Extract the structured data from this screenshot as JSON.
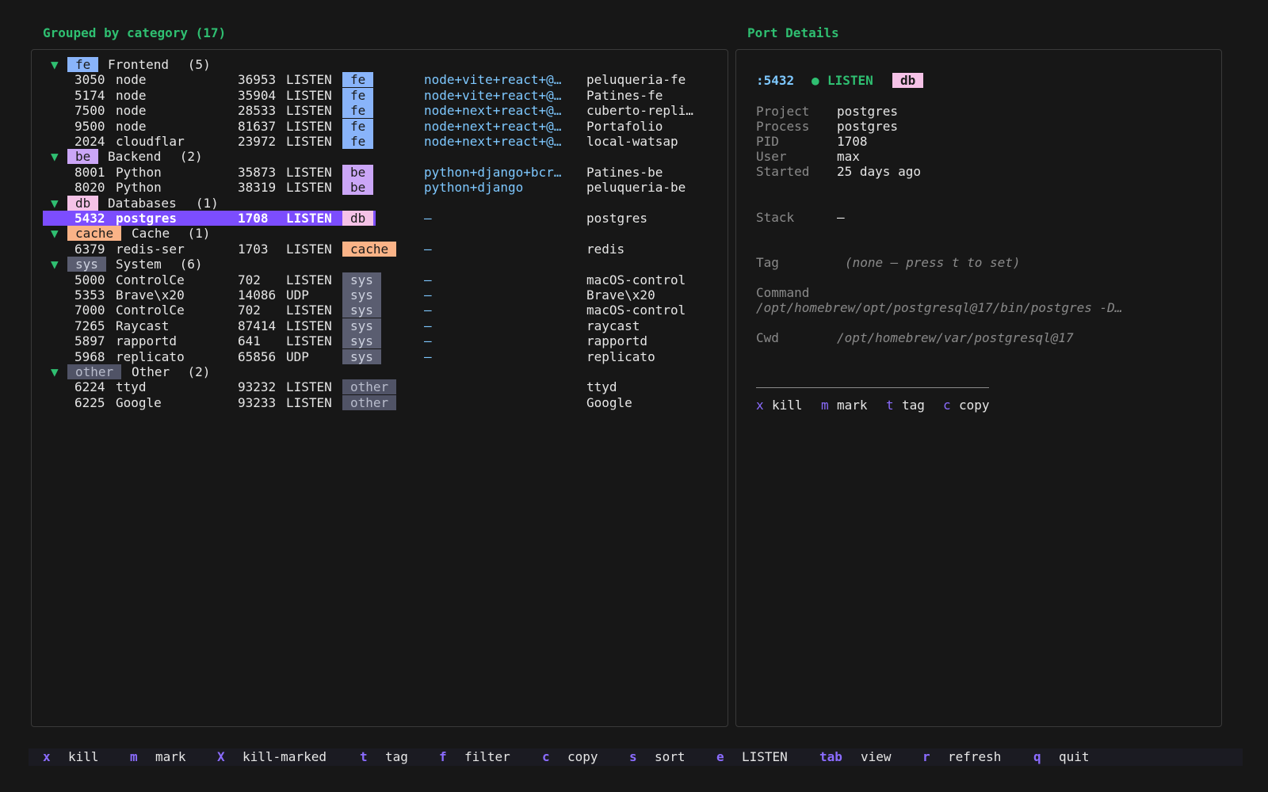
{
  "left_panel": {
    "title": "Grouped by category (17)",
    "groups": [
      {
        "tag": "fe",
        "name": "Frontend",
        "count": "(5)"
      },
      {
        "tag": "be",
        "name": "Backend",
        "count": "(2)"
      },
      {
        "tag": "db",
        "name": "Databases",
        "count": "(1)"
      },
      {
        "tag": "cache",
        "name": "Cache",
        "count": "(1)"
      },
      {
        "tag": "sys",
        "name": "System",
        "count": "(6)"
      },
      {
        "tag": "other",
        "name": "Other",
        "count": "(2)"
      }
    ],
    "rows": [
      {
        "port": "3050",
        "proc": "node",
        "pid": "36953",
        "state": "LISTEN",
        "tag": "fe",
        "stack": "node+vite+react+@…",
        "project": "peluqueria-fe"
      },
      {
        "port": "5174",
        "proc": "node",
        "pid": "35904",
        "state": "LISTEN",
        "tag": "fe",
        "stack": "node+vite+react+@…",
        "project": "Patines-fe"
      },
      {
        "port": "7500",
        "proc": "node",
        "pid": "28533",
        "state": "LISTEN",
        "tag": "fe",
        "stack": "node+next+react+@…",
        "project": "cuberto-repli…"
      },
      {
        "port": "9500",
        "proc": "node",
        "pid": "81637",
        "state": "LISTEN",
        "tag": "fe",
        "stack": "node+next+react+@…",
        "project": "Portafolio"
      },
      {
        "port": "2024",
        "proc": "cloudflar",
        "pid": "23972",
        "state": "LISTEN",
        "tag": "fe",
        "stack": "node+next+react+@…",
        "project": "local-watsap"
      },
      {
        "port": "8001",
        "proc": "Python",
        "pid": "35873",
        "state": "LISTEN",
        "tag": "be",
        "stack": "python+django+bcr…",
        "project": "Patines-be"
      },
      {
        "port": "8020",
        "proc": "Python",
        "pid": "38319",
        "state": "LISTEN",
        "tag": "be",
        "stack": "python+django",
        "project": "peluqueria-be"
      },
      {
        "port": "5432",
        "proc": "postgres",
        "pid": "1708",
        "state": "LISTEN",
        "tag": "db",
        "stack": "—",
        "project": "postgres",
        "selected": true
      },
      {
        "port": "6379",
        "proc": "redis-ser",
        "pid": "1703",
        "state": "LISTEN",
        "tag": "cache",
        "stack": "—",
        "project": "redis"
      },
      {
        "port": "5000",
        "proc": "ControlCe",
        "pid": "702",
        "state": "LISTEN",
        "tag": "sys",
        "stack": "—",
        "project": "macOS-control"
      },
      {
        "port": "5353",
        "proc": "Brave\\x20",
        "pid": "14086",
        "state": "UDP",
        "tag": "sys",
        "stack": "—",
        "project": "Brave\\x20"
      },
      {
        "port": "7000",
        "proc": "ControlCe",
        "pid": "702",
        "state": "LISTEN",
        "tag": "sys",
        "stack": "—",
        "project": "macOS-control"
      },
      {
        "port": "7265",
        "proc": "Raycast",
        "pid": "87414",
        "state": "LISTEN",
        "tag": "sys",
        "stack": "—",
        "project": "raycast"
      },
      {
        "port": "5897",
        "proc": "rapportd",
        "pid": "641",
        "state": "LISTEN",
        "tag": "sys",
        "stack": "—",
        "project": "rapportd"
      },
      {
        "port": "5968",
        "proc": "replicato",
        "pid": "65856",
        "state": "UDP",
        "tag": "sys",
        "stack": "—",
        "project": "replicato"
      },
      {
        "port": "6224",
        "proc": "ttyd",
        "pid": "93232",
        "state": "LISTEN",
        "tag": "other",
        "stack": "",
        "project": "ttyd"
      },
      {
        "port": "6225",
        "proc": "Google",
        "pid": "93233",
        "state": "LISTEN",
        "tag": "other",
        "stack": "",
        "project": "Google"
      }
    ]
  },
  "right_panel": {
    "title": "Port Details",
    "port": ":5432",
    "status_dot": "●",
    "status": "LISTEN",
    "tag": "db",
    "fields": {
      "project_label": "Project",
      "project_value": "postgres",
      "process_label": "Process",
      "process_value": "postgres",
      "pid_label": "PID",
      "pid_value": "1708",
      "user_label": "User",
      "user_value": "max",
      "started_label": "Started",
      "started_value": "25 days ago",
      "stack_label": "Stack",
      "stack_value": "—",
      "tag_label": "Tag",
      "tag_value": "(none — press t to set)",
      "command_label": "Command",
      "command_value": "/opt/homebrew/opt/postgresql@17/bin/postgres -D…",
      "cwd_label": "Cwd",
      "cwd_value": "/opt/homebrew/var/postgresql@17"
    },
    "actions": [
      {
        "key": "x",
        "label": "kill"
      },
      {
        "key": "m",
        "label": "mark"
      },
      {
        "key": "t",
        "label": "tag"
      },
      {
        "key": "c",
        "label": "copy"
      }
    ]
  },
  "footer": [
    {
      "key": "x",
      "label": "kill"
    },
    {
      "key": "m",
      "label": "mark"
    },
    {
      "key": "X",
      "label": "kill-marked"
    },
    {
      "key": "t",
      "label": "tag"
    },
    {
      "key": "f",
      "label": "filter"
    },
    {
      "key": "c",
      "label": "copy"
    },
    {
      "key": "s",
      "label": "sort"
    },
    {
      "key": "e",
      "label": "LISTEN"
    },
    {
      "key": "tab",
      "label": "view"
    },
    {
      "key": "r",
      "label": "refresh"
    },
    {
      "key": "q",
      "label": "quit"
    }
  ],
  "colors": {
    "background": "#171717",
    "accent_green": "#2fbf71",
    "selection": "#7c4dff",
    "key_purple": "#8b6cff",
    "stack_blue": "#7ec8ff"
  }
}
